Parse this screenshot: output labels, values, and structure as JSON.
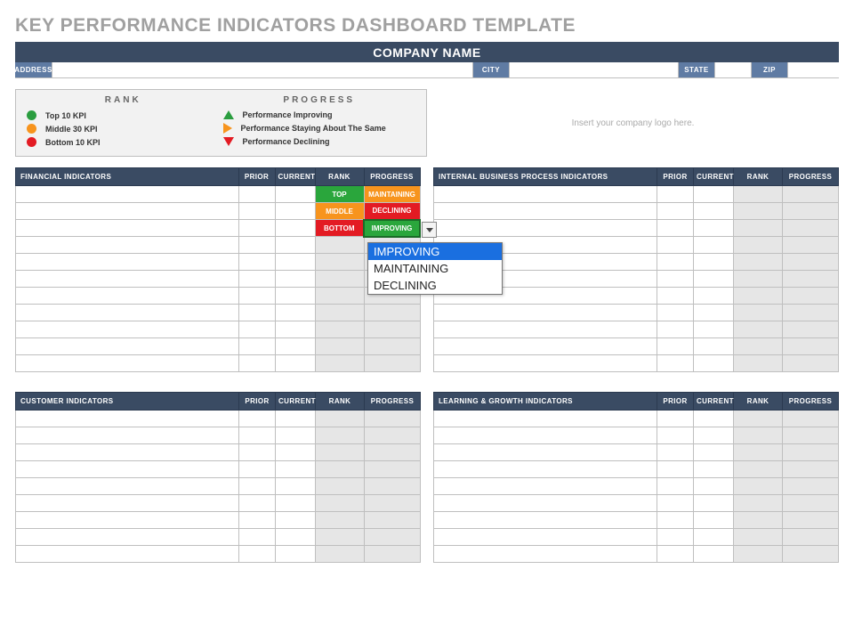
{
  "page_title": "KEY PERFORMANCE INDICATORS DASHBOARD TEMPLATE",
  "company_name_label": "COMPANY NAME",
  "address_labels": {
    "address": "ADDRESS",
    "city": "CITY",
    "state": "STATE",
    "zip": "ZIP"
  },
  "address_values": {
    "address": "",
    "city": "",
    "state": "",
    "zip": ""
  },
  "legend": {
    "rank_title": "RANK",
    "progress_title": "PROGRESS",
    "rank_items": [
      {
        "color": "#2a9d3f",
        "label": "Top 10 KPI"
      },
      {
        "color": "#f7941d",
        "label": "Middle 30 KPI"
      },
      {
        "color": "#e31b23",
        "label": "Bottom 10 KPI"
      }
    ],
    "progress_items": [
      {
        "shape": "up",
        "label": "Performance Improving"
      },
      {
        "shape": "right",
        "label": "Performance Staying About The Same"
      },
      {
        "shape": "down",
        "label": "Performance Declining"
      }
    ]
  },
  "logo_placeholder": "Insert your company logo here.",
  "columns": {
    "name_suffix": "",
    "prior": "PRIOR",
    "current": "CURRENT",
    "rank": "RANK",
    "progress": "PROGRESS"
  },
  "panels": [
    {
      "title": "FINANCIAL INDICATORS",
      "rows": [
        {
          "name": "",
          "prior": "",
          "current": "",
          "rank": "TOP",
          "progress": "MAINTAINING"
        },
        {
          "name": "",
          "prior": "",
          "current": "",
          "rank": "MIDDLE",
          "progress": "DECLINING"
        },
        {
          "name": "",
          "prior": "",
          "current": "",
          "rank": "BOTTOM",
          "progress": "IMPROVING"
        },
        {
          "name": "",
          "prior": "",
          "current": "",
          "rank": "",
          "progress": ""
        },
        {
          "name": "",
          "prior": "",
          "current": "",
          "rank": "",
          "progress": ""
        },
        {
          "name": "",
          "prior": "",
          "current": "",
          "rank": "",
          "progress": ""
        },
        {
          "name": "",
          "prior": "",
          "current": "",
          "rank": "",
          "progress": ""
        },
        {
          "name": "",
          "prior": "",
          "current": "",
          "rank": "",
          "progress": ""
        },
        {
          "name": "",
          "prior": "",
          "current": "",
          "rank": "",
          "progress": ""
        },
        {
          "name": "",
          "prior": "",
          "current": "",
          "rank": "",
          "progress": ""
        },
        {
          "name": "",
          "prior": "",
          "current": "",
          "rank": "",
          "progress": ""
        }
      ]
    },
    {
      "title": "INTERNAL BUSINESS PROCESS INDICATORS",
      "rows": [
        {
          "name": "",
          "prior": "",
          "current": "",
          "rank": "",
          "progress": ""
        },
        {
          "name": "",
          "prior": "",
          "current": "",
          "rank": "",
          "progress": ""
        },
        {
          "name": "",
          "prior": "",
          "current": "",
          "rank": "",
          "progress": ""
        },
        {
          "name": "",
          "prior": "",
          "current": "",
          "rank": "",
          "progress": ""
        },
        {
          "name": "",
          "prior": "",
          "current": "",
          "rank": "",
          "progress": ""
        },
        {
          "name": "",
          "prior": "",
          "current": "",
          "rank": "",
          "progress": ""
        },
        {
          "name": "",
          "prior": "",
          "current": "",
          "rank": "",
          "progress": ""
        },
        {
          "name": "",
          "prior": "",
          "current": "",
          "rank": "",
          "progress": ""
        },
        {
          "name": "",
          "prior": "",
          "current": "",
          "rank": "",
          "progress": ""
        },
        {
          "name": "",
          "prior": "",
          "current": "",
          "rank": "",
          "progress": ""
        },
        {
          "name": "",
          "prior": "",
          "current": "",
          "rank": "",
          "progress": ""
        }
      ]
    },
    {
      "title": "CUSTOMER INDICATORS",
      "rows": [
        {
          "name": "",
          "prior": "",
          "current": "",
          "rank": "",
          "progress": ""
        },
        {
          "name": "",
          "prior": "",
          "current": "",
          "rank": "",
          "progress": ""
        },
        {
          "name": "",
          "prior": "",
          "current": "",
          "rank": "",
          "progress": ""
        },
        {
          "name": "",
          "prior": "",
          "current": "",
          "rank": "",
          "progress": ""
        },
        {
          "name": "",
          "prior": "",
          "current": "",
          "rank": "",
          "progress": ""
        },
        {
          "name": "",
          "prior": "",
          "current": "",
          "rank": "",
          "progress": ""
        },
        {
          "name": "",
          "prior": "",
          "current": "",
          "rank": "",
          "progress": ""
        },
        {
          "name": "",
          "prior": "",
          "current": "",
          "rank": "",
          "progress": ""
        },
        {
          "name": "",
          "prior": "",
          "current": "",
          "rank": "",
          "progress": ""
        }
      ]
    },
    {
      "title": "LEARNING & GROWTH INDICATORS",
      "rows": [
        {
          "name": "",
          "prior": "",
          "current": "",
          "rank": "",
          "progress": ""
        },
        {
          "name": "",
          "prior": "",
          "current": "",
          "rank": "",
          "progress": ""
        },
        {
          "name": "",
          "prior": "",
          "current": "",
          "rank": "",
          "progress": ""
        },
        {
          "name": "",
          "prior": "",
          "current": "",
          "rank": "",
          "progress": ""
        },
        {
          "name": "",
          "prior": "",
          "current": "",
          "rank": "",
          "progress": ""
        },
        {
          "name": "",
          "prior": "",
          "current": "",
          "rank": "",
          "progress": ""
        },
        {
          "name": "",
          "prior": "",
          "current": "",
          "rank": "",
          "progress": ""
        },
        {
          "name": "",
          "prior": "",
          "current": "",
          "rank": "",
          "progress": ""
        },
        {
          "name": "",
          "prior": "",
          "current": "",
          "rank": "",
          "progress": ""
        }
      ]
    }
  ],
  "dropdown": {
    "options": [
      "IMPROVING",
      "MAINTAINING",
      "DECLINING"
    ],
    "selected": "IMPROVING"
  }
}
